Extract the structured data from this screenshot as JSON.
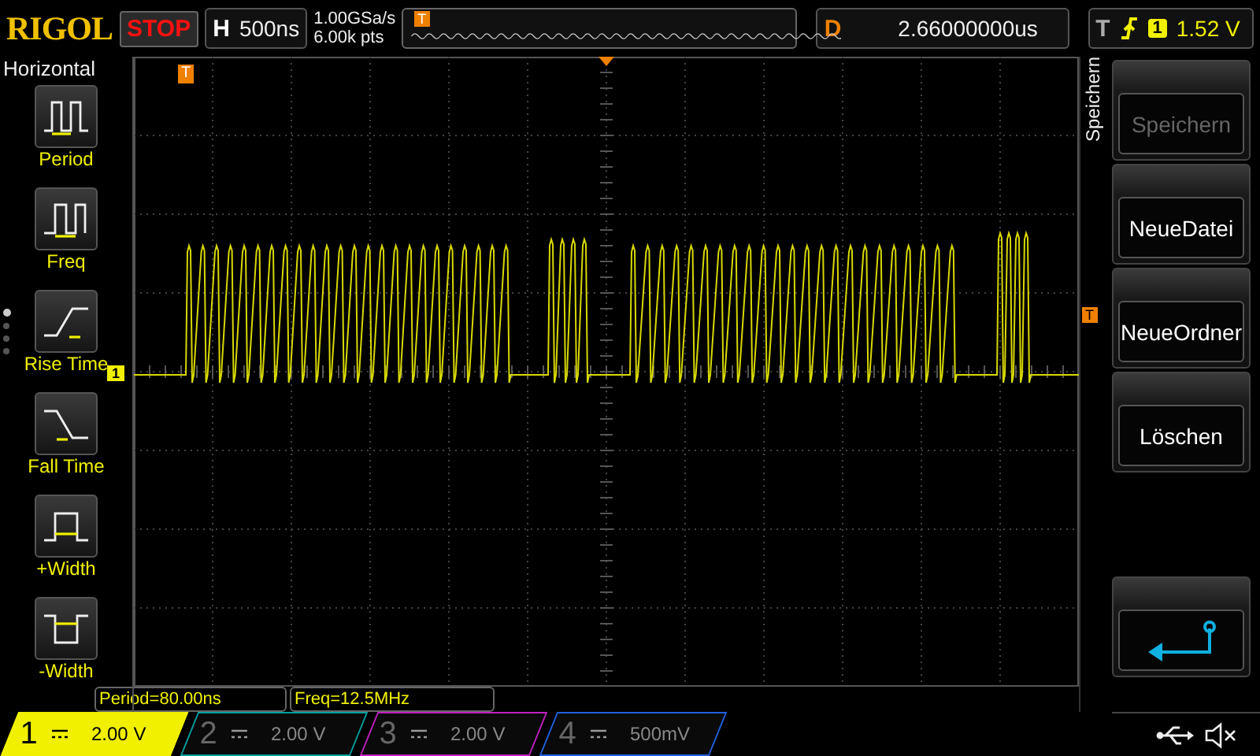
{
  "top_bar": {
    "logo": "RIGOL",
    "run_state": "STOP",
    "timebase": {
      "label": "H",
      "value": "500ns"
    },
    "sample_rate": "1.00GSa/s",
    "memory_depth": "6.00k pts",
    "memory_marker": "T",
    "delay": {
      "label": "D",
      "value": "2.66000000us"
    },
    "trigger": {
      "label": "T",
      "source": "1",
      "level": "1.52 V"
    }
  },
  "left_menu": {
    "title": "Horizontal",
    "page_dots": [
      {
        "selected": true
      },
      {
        "selected": false
      },
      {
        "selected": false
      },
      {
        "selected": false
      }
    ],
    "items": [
      {
        "kind": "period",
        "label": "Period"
      },
      {
        "kind": "freq",
        "label": "Freq"
      },
      {
        "kind": "rise",
        "label": "Rise Time"
      },
      {
        "kind": "fall",
        "label": "Fall Time"
      },
      {
        "kind": "pwidth",
        "label": "+Width"
      },
      {
        "kind": "nwidth",
        "label": "-Width"
      }
    ]
  },
  "screen": {
    "trigger_position_marker": "T",
    "channel_marker": "1",
    "trigger_level_marker": "T"
  },
  "measurements": [
    "Period=80.00ns",
    "Freq=12.5MHz"
  ],
  "right_menu": {
    "title": "Speichern",
    "buttons": [
      {
        "kind": "text",
        "label": "Speichern",
        "disabled": true
      },
      {
        "kind": "text",
        "label": "NeueDatei",
        "disabled": false
      },
      {
        "kind": "text",
        "label": "NeueOrdner",
        "disabled": false
      },
      {
        "kind": "text",
        "label": "Löschen",
        "disabled": false
      },
      {
        "kind": "back"
      }
    ]
  },
  "channels": [
    {
      "number": "1",
      "scale": "2.00 V",
      "selected": true,
      "color": "#f0f000"
    },
    {
      "number": "2",
      "scale": "2.00 V",
      "selected": false,
      "color": "#00a0a0"
    },
    {
      "number": "3",
      "scale": "2.00 V",
      "selected": false,
      "color": "#c020c0"
    },
    {
      "number": "4",
      "scale": "500mV",
      "selected": false,
      "color": "#2060e0"
    }
  ]
}
